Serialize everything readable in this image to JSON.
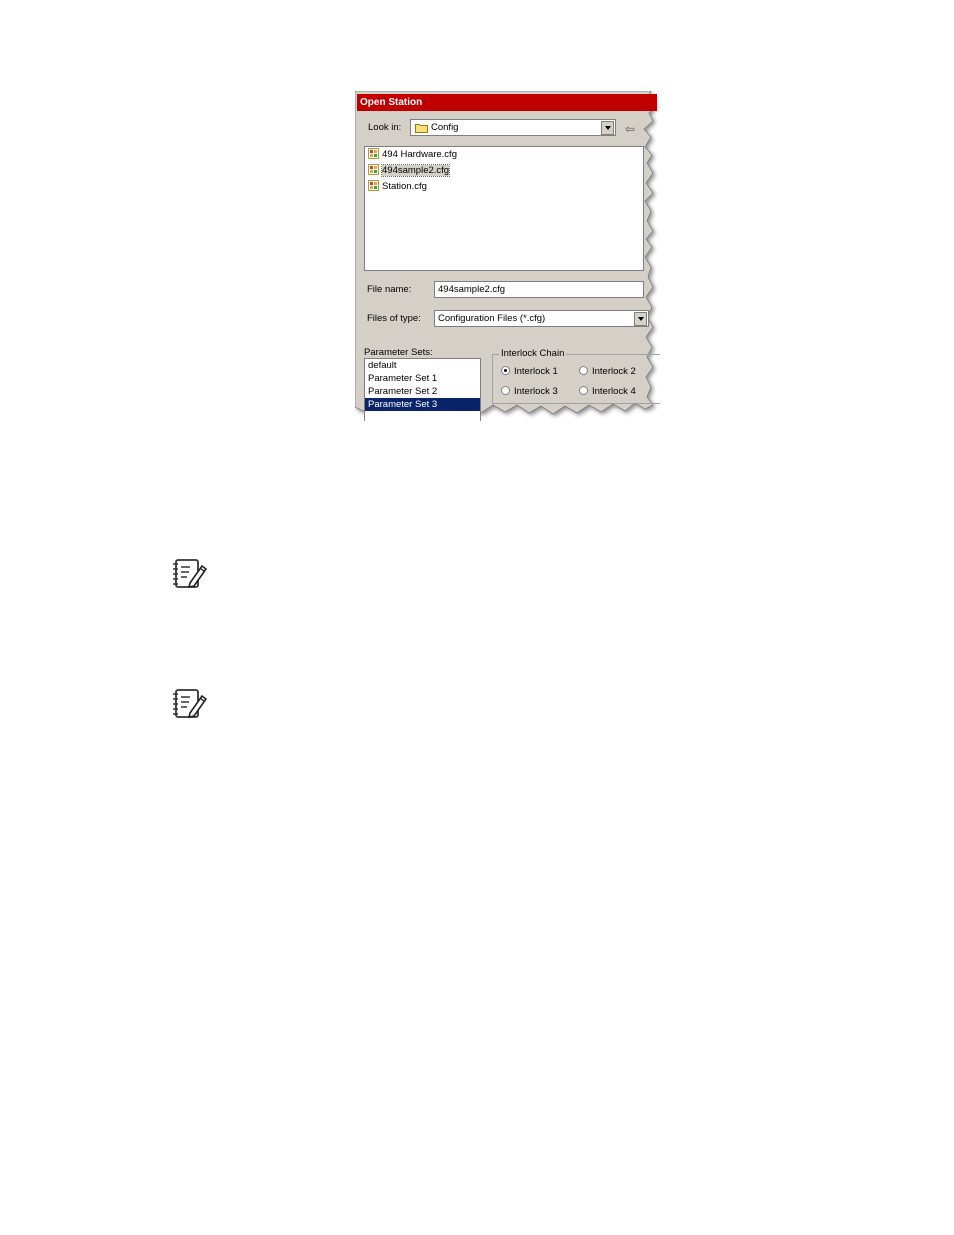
{
  "dialog": {
    "title": "Open Station",
    "look_in_label": "Look in:",
    "look_in_value": "Config",
    "files": [
      {
        "name": "494 Hardware.cfg",
        "selected": false
      },
      {
        "name": "494sample2.cfg",
        "selected": true
      },
      {
        "name": "Station.cfg",
        "selected": false
      }
    ],
    "file_name_label": "File name:",
    "file_name_value": "494sample2.cfg",
    "files_of_type_label": "Files of type:",
    "files_of_type_value": "Configuration Files (*.cfg)",
    "parameter_sets_label": "Parameter Sets:",
    "parameter_sets": [
      {
        "label": "default",
        "selected": false
      },
      {
        "label": "Parameter Set 1",
        "selected": false
      },
      {
        "label": "Parameter Set 2",
        "selected": false
      },
      {
        "label": "Parameter Set 3",
        "selected": true
      }
    ],
    "interlock_chain_label": "Interlock Chain",
    "interlocks": [
      {
        "label": "Interlock 1",
        "checked": true
      },
      {
        "label": "Interlock 2",
        "checked": false
      },
      {
        "label": "Interlock 3",
        "checked": false
      },
      {
        "label": "Interlock 4",
        "checked": false
      }
    ]
  },
  "colors": {
    "title_bar": "#c00000",
    "dialog_face": "#d4d0c8",
    "selection": "#0a246a"
  },
  "icons": {
    "note": "note-pencil-icon",
    "folder": "folder-icon",
    "file": "config-file-icon"
  }
}
